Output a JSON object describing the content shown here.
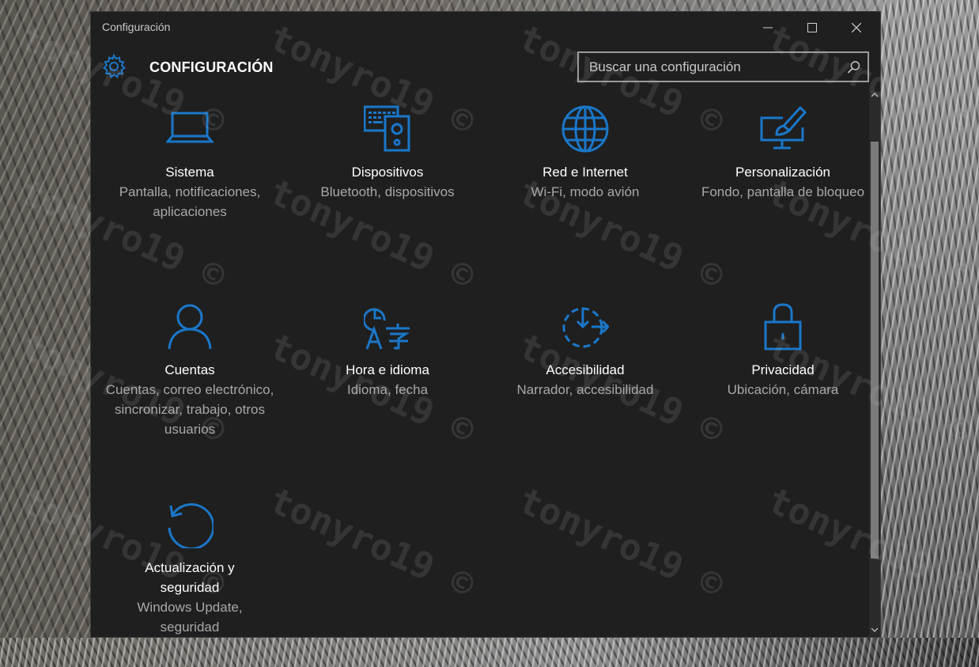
{
  "window": {
    "title": "Configuración"
  },
  "header": {
    "title": "CONFIGURACIÓN",
    "icon": "gear-icon",
    "search_placeholder": "Buscar una configuración"
  },
  "accent_color": "#1a77c9",
  "watermark_text": "tonyro19 ©",
  "tiles": [
    {
      "id": "sistema",
      "icon": "laptop-icon",
      "name": "Sistema",
      "desc": "Pantalla, notificaciones, aplicaciones"
    },
    {
      "id": "dispositivos",
      "icon": "devices-icon",
      "name": "Dispositivos",
      "desc": "Bluetooth, dispositivos"
    },
    {
      "id": "red",
      "icon": "globe-icon",
      "name": "Red e Internet",
      "desc": "Wi-Fi, modo avión"
    },
    {
      "id": "personalizacion",
      "icon": "paint-monitor-icon",
      "name": "Personalización",
      "desc": "Fondo, pantalla de bloqueo"
    },
    {
      "id": "cuentas",
      "icon": "person-icon",
      "name": "Cuentas",
      "desc": "Cuentas, correo electrónico, sincronizar, trabajo, otros usuarios"
    },
    {
      "id": "hora",
      "icon": "time-language-icon",
      "name": "Hora e idioma",
      "desc": "Idioma, fecha"
    },
    {
      "id": "accesibilidad",
      "icon": "accessibility-timer-icon",
      "name": "Accesibilidad",
      "desc": "Narrador, accesibilidad"
    },
    {
      "id": "privacidad",
      "icon": "lock-icon",
      "name": "Privacidad",
      "desc": "Ubicación, cámara"
    },
    {
      "id": "actualizacion",
      "icon": "refresh-icon",
      "name": "Actualización y seguridad",
      "desc": "Windows Update, seguridad"
    }
  ]
}
